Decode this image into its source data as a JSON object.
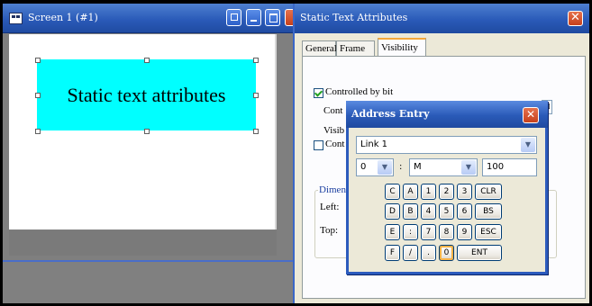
{
  "screen_window": {
    "title": "Screen 1 (#1)",
    "static_text": "Static text attributes",
    "static_text_bg": "#00ffff"
  },
  "dialog": {
    "title": "Static Text Attributes",
    "tabs": [
      "General",
      "Frame",
      "Visibility"
    ],
    "active_tab": "Visibility",
    "controlled_by_bit_label": "Controlled by bit",
    "controlled_by_bit_checked": true,
    "partial_label_1": "Cont",
    "partial_label_2": "Visib",
    "partial_label_3": "Cont",
    "dimension_legend": "Dimen",
    "left_label": "Left:",
    "top_label": "Top:"
  },
  "address_entry": {
    "title": "Address Entry",
    "link_value": "Link 1",
    "station_value": "0",
    "separator": ":",
    "device_value": "M",
    "address_value": "100",
    "keypad": [
      [
        "C",
        "A",
        "1",
        "2",
        "3",
        "CLR"
      ],
      [
        "D",
        "B",
        "4",
        "5",
        "6",
        "BS"
      ],
      [
        "E",
        ":",
        "7",
        "8",
        "9",
        "ESC"
      ],
      [
        "F",
        "/",
        ".",
        "0",
        "ENT"
      ]
    ],
    "focused_key": "0"
  },
  "colors": {
    "titlebar": "#2a5ab8",
    "dialog_bg": "#ece9d8",
    "close_button": "#c6401b"
  }
}
